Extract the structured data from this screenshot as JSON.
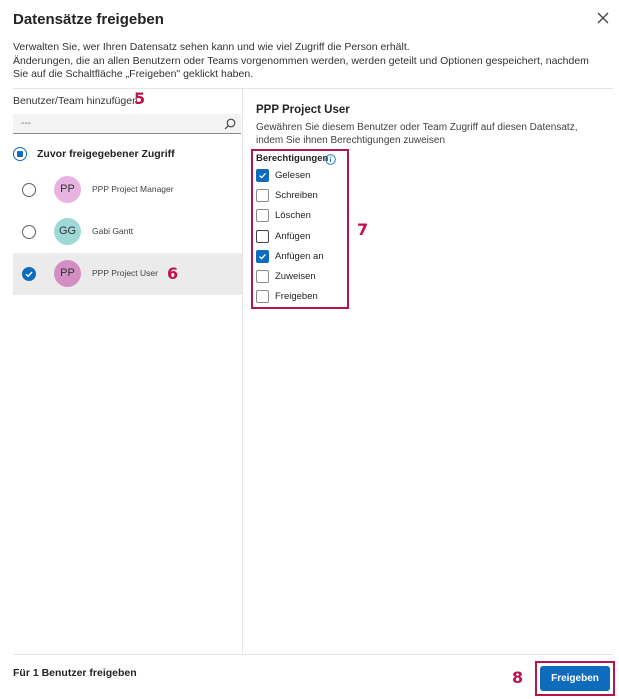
{
  "dialog": {
    "title": "Datensätze freigeben",
    "description_line1": "Verwalten Sie, wer Ihren Datensatz sehen kann und wie viel Zugriff die Person erhält.",
    "description_line2": "Änderungen, die an allen Benutzern oder Teams vorgenommen werden, werden geteilt und Optionen gespeichert, nachdem Sie auf die Schaltfläche „Freigeben\" geklickt haben."
  },
  "left": {
    "add_label": "Benutzer/Team hinzufügen",
    "search_placeholder": "---",
    "previous_access_label": "Zuvor freigegebener Zugriff",
    "users": [
      {
        "initials": "PP",
        "name": "PPP Project Manager",
        "avatar_color": "#e8b3e0",
        "selected": false
      },
      {
        "initials": "GG",
        "name": "Gabi Gantt",
        "avatar_color": "#9fd9d7",
        "selected": false
      },
      {
        "initials": "PP",
        "name": "PPP Project User",
        "avatar_color": "#d38fc4",
        "selected": true
      }
    ]
  },
  "right": {
    "title": "PPP Project User",
    "description": "Gewähren Sie diesem Benutzer oder Team Zugriff auf diesen Datensatz, indem Sie ihnen Berechtigungen zuweisen",
    "permissions_heading": "Berechtigungen",
    "permissions": [
      {
        "label": "Gelesen",
        "checked": true
      },
      {
        "label": "Schreiben",
        "checked": false
      },
      {
        "label": "Löschen",
        "checked": false
      },
      {
        "label": "Anfügen",
        "checked": false
      },
      {
        "label": "Anfügen an",
        "checked": true
      },
      {
        "label": "Zuweisen",
        "checked": false
      },
      {
        "label": "Freigeben",
        "checked": false
      }
    ]
  },
  "footer": {
    "summary": "Für 1 Benutzer freigeben",
    "share_button": "Freigeben"
  },
  "callouts": {
    "c5": "5",
    "c6": "6",
    "c7": "7",
    "c8": "8"
  },
  "colors": {
    "accent": "#0f6cbd",
    "callout": "#c0134c",
    "highlight_border": "#b5144f"
  }
}
